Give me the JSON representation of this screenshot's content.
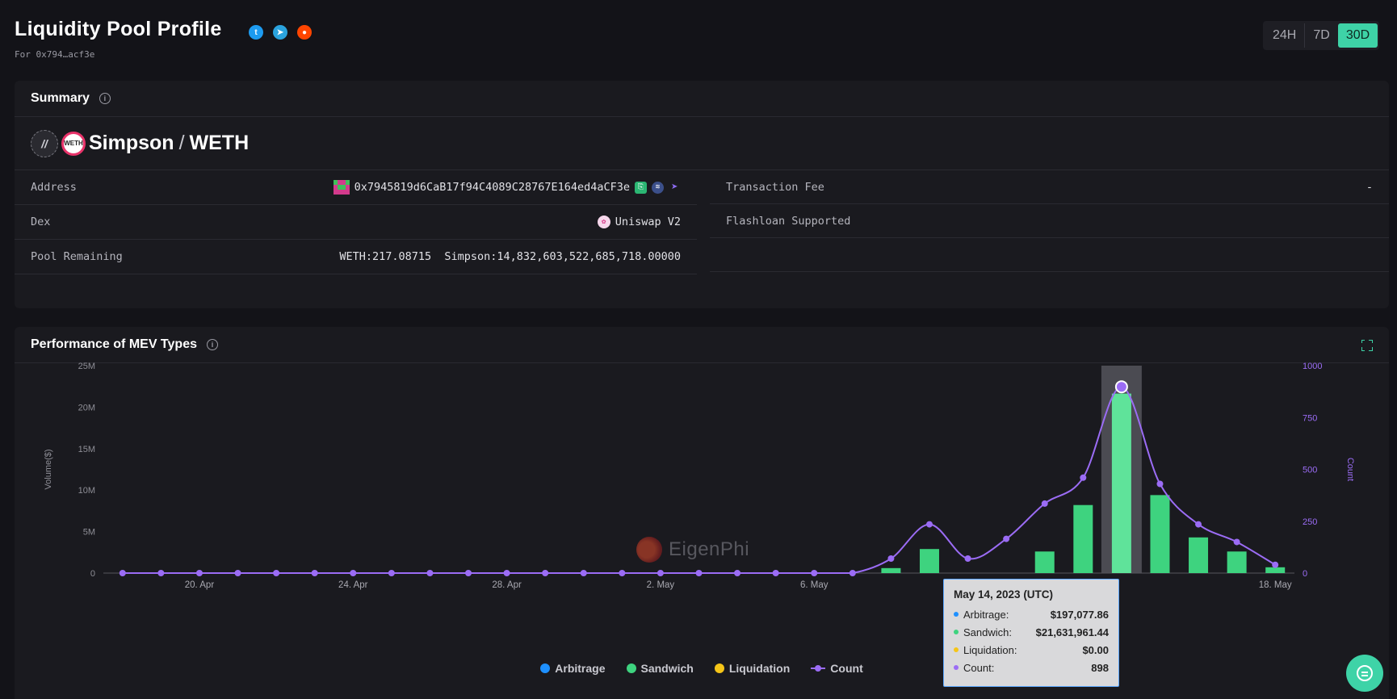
{
  "header": {
    "title": "Liquidity Pool Profile",
    "subtitle": "For 0x794…acf3e",
    "socials": [
      "twitter-icon",
      "telegram-icon",
      "reddit-icon"
    ],
    "ranges": [
      "24H",
      "7D",
      "30D"
    ],
    "active_range": "30D"
  },
  "summary": {
    "title": "Summary",
    "pair": {
      "token1": "Simpson",
      "separator": "/",
      "token2": "WETH",
      "token2_logo_text": "WETH"
    },
    "left_rows": [
      {
        "label": "Address",
        "value": "0x7945819d6CaB17f94C4089C28767E164ed4aCF3e"
      },
      {
        "label": "Dex",
        "value": "Uniswap V2"
      },
      {
        "label": "Pool Remaining",
        "value": "WETH:217.08715  Simpson:14,832,603,522,685,718.00000"
      }
    ],
    "right_rows": [
      {
        "label": "Transaction Fee",
        "value": "-"
      },
      {
        "label": "Flashloan Supported",
        "value": ""
      }
    ]
  },
  "performance": {
    "title": "Performance of MEV Types",
    "watermark": "EigenPhi",
    "legend": [
      {
        "label": "Arbitrage",
        "color": "#1e90ff"
      },
      {
        "label": "Sandwich",
        "color": "#3ed37f"
      },
      {
        "label": "Liquidation",
        "color": "#f5c518"
      },
      {
        "label": "Count",
        "color": "#9b6cf5"
      }
    ],
    "tooltip": {
      "title": "May 14, 2023 (UTC)",
      "rows": [
        {
          "label": "Arbitrage:",
          "value": "$197,077.86",
          "color": "#1e90ff"
        },
        {
          "label": "Sandwich:",
          "value": "$21,631,961.44",
          "color": "#3ed37f"
        },
        {
          "label": "Liquidation:",
          "value": "$0.00",
          "color": "#f5c518"
        },
        {
          "label": "Count:",
          "value": "898",
          "color": "#9b6cf5"
        }
      ]
    }
  },
  "chart_data": {
    "type": "bar",
    "ylabel": "Volume($)",
    "y2label": "Count",
    "ylim": [
      0,
      25000000
    ],
    "y2lim": [
      0,
      1000
    ],
    "yticks": [
      "0",
      "5M",
      "10M",
      "15M",
      "20M",
      "25M"
    ],
    "y2ticks": [
      "0",
      "250",
      "500",
      "750",
      "1000"
    ],
    "x_tick_labels": [
      "20. Apr",
      "24. Apr",
      "28. Apr",
      "2. May",
      "6. May",
      "",
      "",
      "18. May"
    ],
    "x": [
      "Apr 18",
      "Apr 19",
      "Apr 20",
      "Apr 21",
      "Apr 22",
      "Apr 23",
      "Apr 24",
      "Apr 25",
      "Apr 26",
      "Apr 27",
      "Apr 28",
      "Apr 29",
      "Apr 30",
      "May 1",
      "May 2",
      "May 3",
      "May 4",
      "May 5",
      "May 6",
      "May 7",
      "May 8",
      "May 9",
      "May 10",
      "May 11",
      "May 12",
      "May 13",
      "May 14",
      "May 15",
      "May 16",
      "May 17",
      "May 18"
    ],
    "series": [
      {
        "name": "Sandwich",
        "type": "bar",
        "values": [
          0,
          0,
          0,
          0,
          0,
          0,
          0,
          0,
          0,
          0,
          0,
          0,
          0,
          0,
          0,
          0,
          0,
          0,
          0,
          0,
          600000,
          2900000,
          0,
          0,
          2600000,
          8200000,
          21631961,
          9400000,
          4300000,
          2600000,
          700000
        ]
      },
      {
        "name": "Count",
        "type": "line",
        "axis": "right",
        "values": [
          0,
          0,
          0,
          0,
          0,
          0,
          0,
          0,
          0,
          0,
          0,
          0,
          0,
          0,
          0,
          0,
          0,
          0,
          0,
          0,
          70,
          235,
          70,
          165,
          335,
          460,
          898,
          430,
          235,
          150,
          40
        ]
      }
    ],
    "highlight_index": 26
  }
}
